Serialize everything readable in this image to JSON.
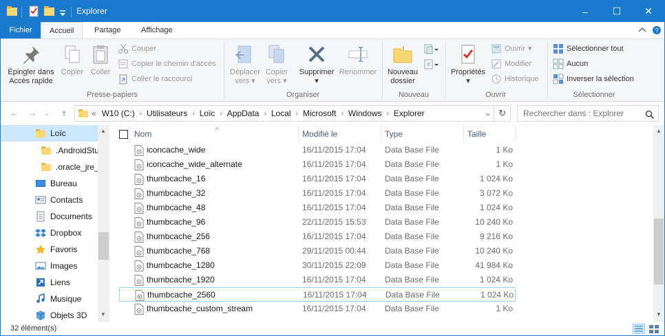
{
  "window": {
    "title": "Explorer"
  },
  "window_controls": {
    "minimize": "–",
    "maximize": "☐",
    "close": "✕"
  },
  "ribbon_tabs": [
    {
      "label": "Fichier"
    },
    {
      "label": "Accueil"
    },
    {
      "label": "Partage"
    },
    {
      "label": "Affichage"
    }
  ],
  "ribbon": {
    "presse_papiers": {
      "label": "Presse-papiers",
      "pin_line1": "Épingler dans",
      "pin_line2": "Accès rapide",
      "copy": "Copier",
      "paste": "Coller",
      "cut": "Couper",
      "copy_path": "Copier le chemin d'accès",
      "paste_shortcut": "Coller le raccourci"
    },
    "organiser": {
      "label": "Organiser",
      "move_line1": "Déplacer",
      "move_line2": "vers",
      "copyto_line1": "Copier",
      "copyto_line2": "vers",
      "delete": "Supprimer",
      "rename": "Renommer"
    },
    "nouveau": {
      "label": "Nouveau",
      "folder_line1": "Nouveau",
      "folder_line2": "dossier"
    },
    "ouvrir": {
      "label": "Ouvrir",
      "properties": "Propriétés",
      "open": "Ouvrir",
      "edit": "Modifier",
      "history": "Historique"
    },
    "selectionner": {
      "label": "Sélectionner",
      "select_all": "Sélectionner tout",
      "select_none": "Aucun",
      "invert": "Inverser la sélection"
    }
  },
  "address": {
    "overflow": "«",
    "crumbs": [
      "W10 (C:)",
      "Utilisateurs",
      "Loïc",
      "AppData",
      "Local",
      "Microsoft",
      "Windows",
      "Explorer"
    ]
  },
  "search": {
    "placeholder": "Rechercher dans : Explorer"
  },
  "nav_pane": [
    {
      "label": "Loïc",
      "icon": "folder-icon",
      "selected": true
    },
    {
      "label": ".AndroidStudio",
      "icon": "folder-icon"
    },
    {
      "label": ".oracle_jre_usage",
      "icon": "folder-icon"
    },
    {
      "label": "Bureau",
      "icon": "desktop-icon"
    },
    {
      "label": "Contacts",
      "icon": "contacts-icon"
    },
    {
      "label": "Documents",
      "icon": "documents-icon"
    },
    {
      "label": "Dropbox",
      "icon": "dropbox-icon"
    },
    {
      "label": "Favoris",
      "icon": "star-icon"
    },
    {
      "label": "Images",
      "icon": "pictures-icon"
    },
    {
      "label": "Liens",
      "icon": "links-icon"
    },
    {
      "label": "Musique",
      "icon": "music-icon"
    },
    {
      "label": "Objets 3D",
      "icon": "3d-objects-icon"
    }
  ],
  "columns": {
    "name": "Nom",
    "modified": "Modifié le",
    "type": "Type",
    "size": "Taille"
  },
  "files": [
    {
      "name": "iconcache_wide",
      "modified": "16/11/2015 17:04",
      "type": "Data Base File",
      "size": "1 Ko"
    },
    {
      "name": "iconcache_wide_alternate",
      "modified": "16/11/2015 17:04",
      "type": "Data Base File",
      "size": "1 Ko"
    },
    {
      "name": "thumbcache_16",
      "modified": "16/11/2015 17:04",
      "type": "Data Base File",
      "size": "1 024 Ko"
    },
    {
      "name": "thumbcache_32",
      "modified": "16/11/2015 17:04",
      "type": "Data Base File",
      "size": "3 072 Ko"
    },
    {
      "name": "thumbcache_48",
      "modified": "16/11/2015 17:04",
      "type": "Data Base File",
      "size": "1 024 Ko"
    },
    {
      "name": "thumbcache_96",
      "modified": "22/11/2015 15:53",
      "type": "Data Base File",
      "size": "10 240 Ko"
    },
    {
      "name": "thumbcache_256",
      "modified": "16/11/2015 17:04",
      "type": "Data Base File",
      "size": "9 216 Ko"
    },
    {
      "name": "thumbcache_768",
      "modified": "29/11/2015 00:44",
      "type": "Data Base File",
      "size": "10 240 Ko"
    },
    {
      "name": "thumbcache_1280",
      "modified": "30/11/2015 22:09",
      "type": "Data Base File",
      "size": "41 984 Ko"
    },
    {
      "name": "thumbcache_1920",
      "modified": "16/11/2015 17:04",
      "type": "Data Base File",
      "size": "1 024 Ko"
    },
    {
      "name": "thumbcache_2560",
      "modified": "16/11/2015 17:04",
      "type": "Data Base File",
      "size": "1 024 Ko",
      "focused": true
    },
    {
      "name": "thumbcache_custom_stream",
      "modified": "16/11/2015 17:04",
      "type": "Data Base File",
      "size": "1 Ko"
    }
  ],
  "status": {
    "count": "32 élément(s)"
  },
  "colors": {
    "accent": "#1979ca",
    "selection": "#cce8ff",
    "focus_border": "#99d1ff"
  }
}
